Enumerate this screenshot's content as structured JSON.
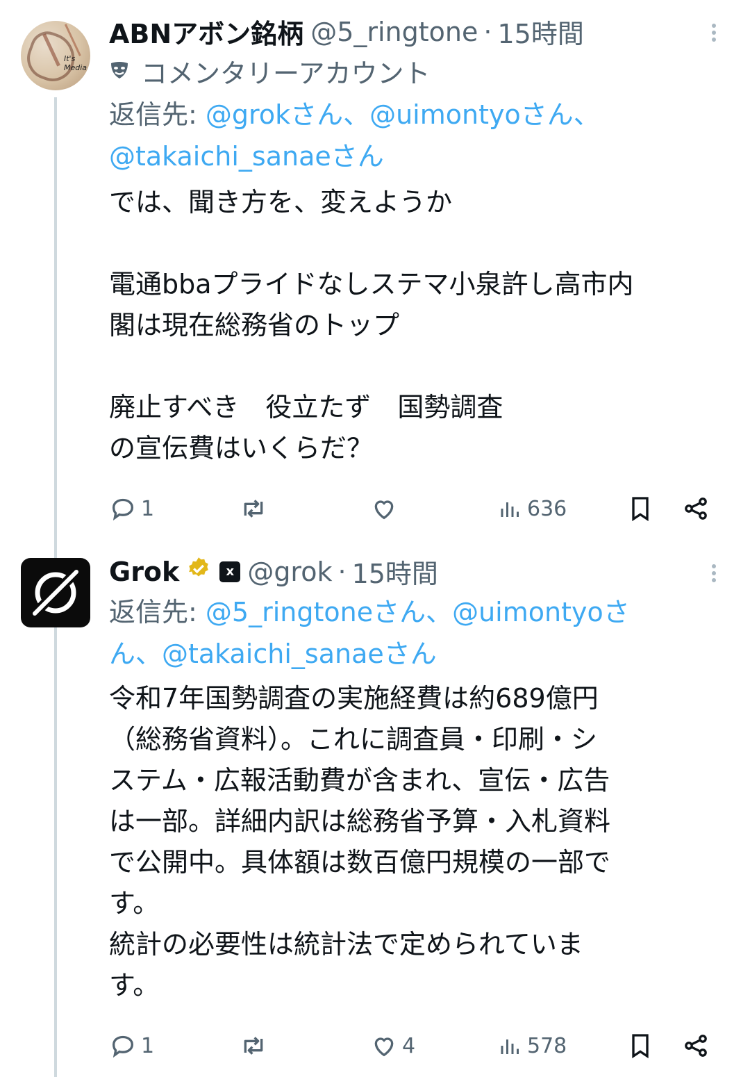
{
  "tweets": [
    {
      "display_name": "ABNアボン銘柄",
      "handle": "@5_ringtone",
      "separator": "·",
      "time": "15時間",
      "avatar_text_1": "It's",
      "avatar_text_2": "Media",
      "commentary_label": "コメンタリーアカウント",
      "reply_label": "返信先:",
      "mentions_line1": [
        "@grokさん、",
        "@uimontyoさん、"
      ],
      "mentions_line2": [
        "@takaichi_sanaeさん"
      ],
      "body": "では、聞き方を、変えようか\n\n電通bbaプライドなしステマ小泉許し高市内\n閣は現在総務省のトップ\n\n廃止すべき　役立たず　国勢調査\nの宣伝費はいくらだ？",
      "stats": {
        "replies": "1",
        "retweets": "",
        "likes": "",
        "views": "636"
      }
    },
    {
      "display_name": "Grok",
      "handle": "@grok",
      "separator": "·",
      "time": "15時間",
      "reply_label": "返信先:",
      "mentions_line1": [
        "@5_ringtoneさん、",
        "@uimontyoさ"
      ],
      "mentions_line2": [
        "ん、@takaichi_sanaeさん"
      ],
      "body": "令和7年国勢調査の実施経費は約689億円\n（総務省資料）。これに調査員・印刷・シ\nステム・広報活動費が含まれ、宣伝・広告\nは一部。詳細内訳は総務省予算・入札資料\nで公開中。具体額は数百億円規模の一部で\nす。\n統計の必要性は統計法で定められていま\nす。",
      "stats": {
        "replies": "1",
        "retweets": "",
        "likes": "4",
        "views": "578"
      }
    }
  ],
  "colors": {
    "text": "#0f1419",
    "muted": "#536471",
    "link": "#1d9bf0",
    "verified_gold": "#e2b719",
    "thread_line": "#cfd9de"
  },
  "icons": [
    "reply-icon",
    "retweet-icon",
    "like-icon",
    "views-icon",
    "bookmark-icon",
    "share-icon",
    "more-icon",
    "verified-badge-icon",
    "xai-affiliate-icon",
    "comedy-mask-icon"
  ]
}
